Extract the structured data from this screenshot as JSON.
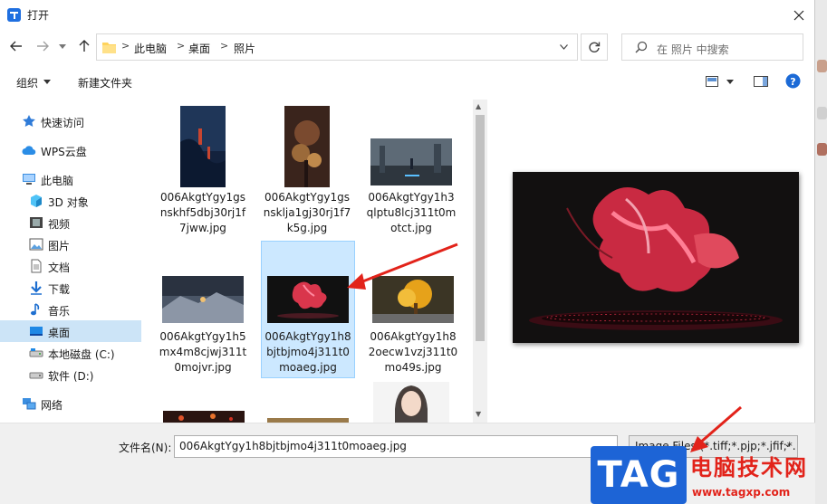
{
  "window": {
    "title": "打开"
  },
  "address": {
    "crumbs": [
      "此电脑",
      "桌面",
      "照片"
    ],
    "separator": ">",
    "search_placeholder": "在 照片 中搜索"
  },
  "toolbar": {
    "organize": "组织",
    "new_folder": "新建文件夹"
  },
  "nav": {
    "items": [
      {
        "label": "快速访问",
        "icon": "star-pin-icon"
      },
      {
        "label": "WPS云盘",
        "icon": "cloud-icon"
      },
      {
        "label": "此电脑",
        "icon": "computer-icon"
      },
      {
        "label": "3D 对象",
        "icon": "cube-3d-icon"
      },
      {
        "label": "视频",
        "icon": "video-icon"
      },
      {
        "label": "图片",
        "icon": "pictures-icon"
      },
      {
        "label": "文档",
        "icon": "documents-icon"
      },
      {
        "label": "下载",
        "icon": "download-icon"
      },
      {
        "label": "音乐",
        "icon": "music-icon"
      },
      {
        "label": "桌面",
        "icon": "desktop-icon"
      },
      {
        "label": "本地磁盘 (C:)",
        "icon": "drive-icon"
      },
      {
        "label": "软件 (D:)",
        "icon": "drive-icon"
      },
      {
        "label": "网络",
        "icon": "network-icon"
      }
    ],
    "selected": "桌面"
  },
  "files": [
    {
      "name_lines": [
        "006AkgtYgy1gs",
        "nskhf5dbj30rj1f",
        "7jww.jpg"
      ]
    },
    {
      "name_lines": [
        "006AkgtYgy1gs",
        "nsklja1gj30rj1f7",
        "k5g.jpg"
      ]
    },
    {
      "name_lines": [
        "006AkgtYgy1h3",
        "qlptu8lcj311t0m",
        "otct.jpg"
      ]
    },
    {
      "name_lines": [
        "006AkgtYgy1h5",
        "mx4m8cjwj311t",
        "0mojvr.jpg"
      ]
    },
    {
      "name_lines": [
        "006AkgtYgy1h8",
        "bjtbjmo4j311t0",
        "moaeg.jpg"
      ]
    },
    {
      "name_lines": [
        "006AkgtYgy1h8",
        "2oecw1vzj311t0",
        "mo49s.jpg"
      ]
    }
  ],
  "selected_file_index": 4,
  "bottom": {
    "filename_label": "文件名(N):",
    "filename_value": "006AkgtYgy1h8bjtbjmo4j311t0moaeg.jpg",
    "filetype_value": "Image Files (*.tiff;*.pjp;*.jfif;*."
  },
  "watermark": {
    "tag": "TAG",
    "site": "电脑技术网",
    "url": "www.tagxp.com"
  },
  "colors": {
    "selection": "#cce4f7",
    "tile_selection": "#cce8ff",
    "accent": "#0067c0",
    "arrow": "#e2231a"
  }
}
